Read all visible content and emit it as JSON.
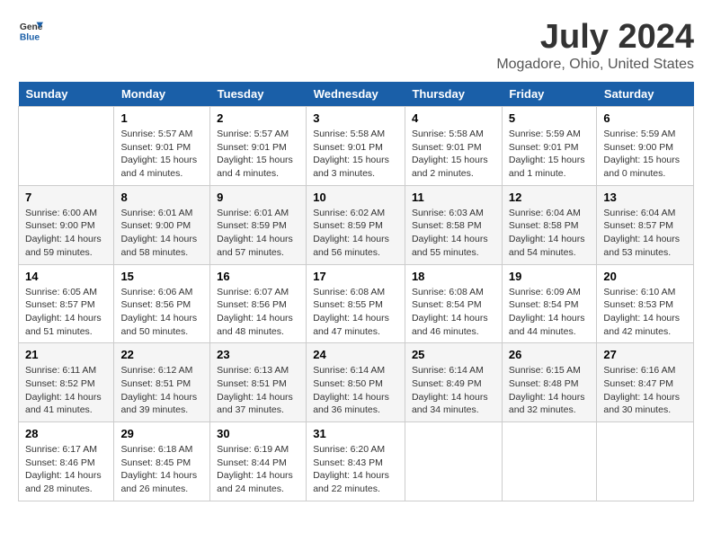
{
  "header": {
    "logo_general": "General",
    "logo_blue": "Blue",
    "title": "July 2024",
    "subtitle": "Mogadore, Ohio, United States"
  },
  "days_of_week": [
    "Sunday",
    "Monday",
    "Tuesday",
    "Wednesday",
    "Thursday",
    "Friday",
    "Saturday"
  ],
  "weeks": [
    [
      {
        "day": "",
        "sunrise": "",
        "sunset": "",
        "daylight": ""
      },
      {
        "day": "1",
        "sunrise": "Sunrise: 5:57 AM",
        "sunset": "Sunset: 9:01 PM",
        "daylight": "Daylight: 15 hours and 4 minutes."
      },
      {
        "day": "2",
        "sunrise": "Sunrise: 5:57 AM",
        "sunset": "Sunset: 9:01 PM",
        "daylight": "Daylight: 15 hours and 4 minutes."
      },
      {
        "day": "3",
        "sunrise": "Sunrise: 5:58 AM",
        "sunset": "Sunset: 9:01 PM",
        "daylight": "Daylight: 15 hours and 3 minutes."
      },
      {
        "day": "4",
        "sunrise": "Sunrise: 5:58 AM",
        "sunset": "Sunset: 9:01 PM",
        "daylight": "Daylight: 15 hours and 2 minutes."
      },
      {
        "day": "5",
        "sunrise": "Sunrise: 5:59 AM",
        "sunset": "Sunset: 9:01 PM",
        "daylight": "Daylight: 15 hours and 1 minute."
      },
      {
        "day": "6",
        "sunrise": "Sunrise: 5:59 AM",
        "sunset": "Sunset: 9:00 PM",
        "daylight": "Daylight: 15 hours and 0 minutes."
      }
    ],
    [
      {
        "day": "7",
        "sunrise": "Sunrise: 6:00 AM",
        "sunset": "Sunset: 9:00 PM",
        "daylight": "Daylight: 14 hours and 59 minutes."
      },
      {
        "day": "8",
        "sunrise": "Sunrise: 6:01 AM",
        "sunset": "Sunset: 9:00 PM",
        "daylight": "Daylight: 14 hours and 58 minutes."
      },
      {
        "day": "9",
        "sunrise": "Sunrise: 6:01 AM",
        "sunset": "Sunset: 8:59 PM",
        "daylight": "Daylight: 14 hours and 57 minutes."
      },
      {
        "day": "10",
        "sunrise": "Sunrise: 6:02 AM",
        "sunset": "Sunset: 8:59 PM",
        "daylight": "Daylight: 14 hours and 56 minutes."
      },
      {
        "day": "11",
        "sunrise": "Sunrise: 6:03 AM",
        "sunset": "Sunset: 8:58 PM",
        "daylight": "Daylight: 14 hours and 55 minutes."
      },
      {
        "day": "12",
        "sunrise": "Sunrise: 6:04 AM",
        "sunset": "Sunset: 8:58 PM",
        "daylight": "Daylight: 14 hours and 54 minutes."
      },
      {
        "day": "13",
        "sunrise": "Sunrise: 6:04 AM",
        "sunset": "Sunset: 8:57 PM",
        "daylight": "Daylight: 14 hours and 53 minutes."
      }
    ],
    [
      {
        "day": "14",
        "sunrise": "Sunrise: 6:05 AM",
        "sunset": "Sunset: 8:57 PM",
        "daylight": "Daylight: 14 hours and 51 minutes."
      },
      {
        "day": "15",
        "sunrise": "Sunrise: 6:06 AM",
        "sunset": "Sunset: 8:56 PM",
        "daylight": "Daylight: 14 hours and 50 minutes."
      },
      {
        "day": "16",
        "sunrise": "Sunrise: 6:07 AM",
        "sunset": "Sunset: 8:56 PM",
        "daylight": "Daylight: 14 hours and 48 minutes."
      },
      {
        "day": "17",
        "sunrise": "Sunrise: 6:08 AM",
        "sunset": "Sunset: 8:55 PM",
        "daylight": "Daylight: 14 hours and 47 minutes."
      },
      {
        "day": "18",
        "sunrise": "Sunrise: 6:08 AM",
        "sunset": "Sunset: 8:54 PM",
        "daylight": "Daylight: 14 hours and 46 minutes."
      },
      {
        "day": "19",
        "sunrise": "Sunrise: 6:09 AM",
        "sunset": "Sunset: 8:54 PM",
        "daylight": "Daylight: 14 hours and 44 minutes."
      },
      {
        "day": "20",
        "sunrise": "Sunrise: 6:10 AM",
        "sunset": "Sunset: 8:53 PM",
        "daylight": "Daylight: 14 hours and 42 minutes."
      }
    ],
    [
      {
        "day": "21",
        "sunrise": "Sunrise: 6:11 AM",
        "sunset": "Sunset: 8:52 PM",
        "daylight": "Daylight: 14 hours and 41 minutes."
      },
      {
        "day": "22",
        "sunrise": "Sunrise: 6:12 AM",
        "sunset": "Sunset: 8:51 PM",
        "daylight": "Daylight: 14 hours and 39 minutes."
      },
      {
        "day": "23",
        "sunrise": "Sunrise: 6:13 AM",
        "sunset": "Sunset: 8:51 PM",
        "daylight": "Daylight: 14 hours and 37 minutes."
      },
      {
        "day": "24",
        "sunrise": "Sunrise: 6:14 AM",
        "sunset": "Sunset: 8:50 PM",
        "daylight": "Daylight: 14 hours and 36 minutes."
      },
      {
        "day": "25",
        "sunrise": "Sunrise: 6:14 AM",
        "sunset": "Sunset: 8:49 PM",
        "daylight": "Daylight: 14 hours and 34 minutes."
      },
      {
        "day": "26",
        "sunrise": "Sunrise: 6:15 AM",
        "sunset": "Sunset: 8:48 PM",
        "daylight": "Daylight: 14 hours and 32 minutes."
      },
      {
        "day": "27",
        "sunrise": "Sunrise: 6:16 AM",
        "sunset": "Sunset: 8:47 PM",
        "daylight": "Daylight: 14 hours and 30 minutes."
      }
    ],
    [
      {
        "day": "28",
        "sunrise": "Sunrise: 6:17 AM",
        "sunset": "Sunset: 8:46 PM",
        "daylight": "Daylight: 14 hours and 28 minutes."
      },
      {
        "day": "29",
        "sunrise": "Sunrise: 6:18 AM",
        "sunset": "Sunset: 8:45 PM",
        "daylight": "Daylight: 14 hours and 26 minutes."
      },
      {
        "day": "30",
        "sunrise": "Sunrise: 6:19 AM",
        "sunset": "Sunset: 8:44 PM",
        "daylight": "Daylight: 14 hours and 24 minutes."
      },
      {
        "day": "31",
        "sunrise": "Sunrise: 6:20 AM",
        "sunset": "Sunset: 8:43 PM",
        "daylight": "Daylight: 14 hours and 22 minutes."
      },
      {
        "day": "",
        "sunrise": "",
        "sunset": "",
        "daylight": ""
      },
      {
        "day": "",
        "sunrise": "",
        "sunset": "",
        "daylight": ""
      },
      {
        "day": "",
        "sunrise": "",
        "sunset": "",
        "daylight": ""
      }
    ]
  ]
}
